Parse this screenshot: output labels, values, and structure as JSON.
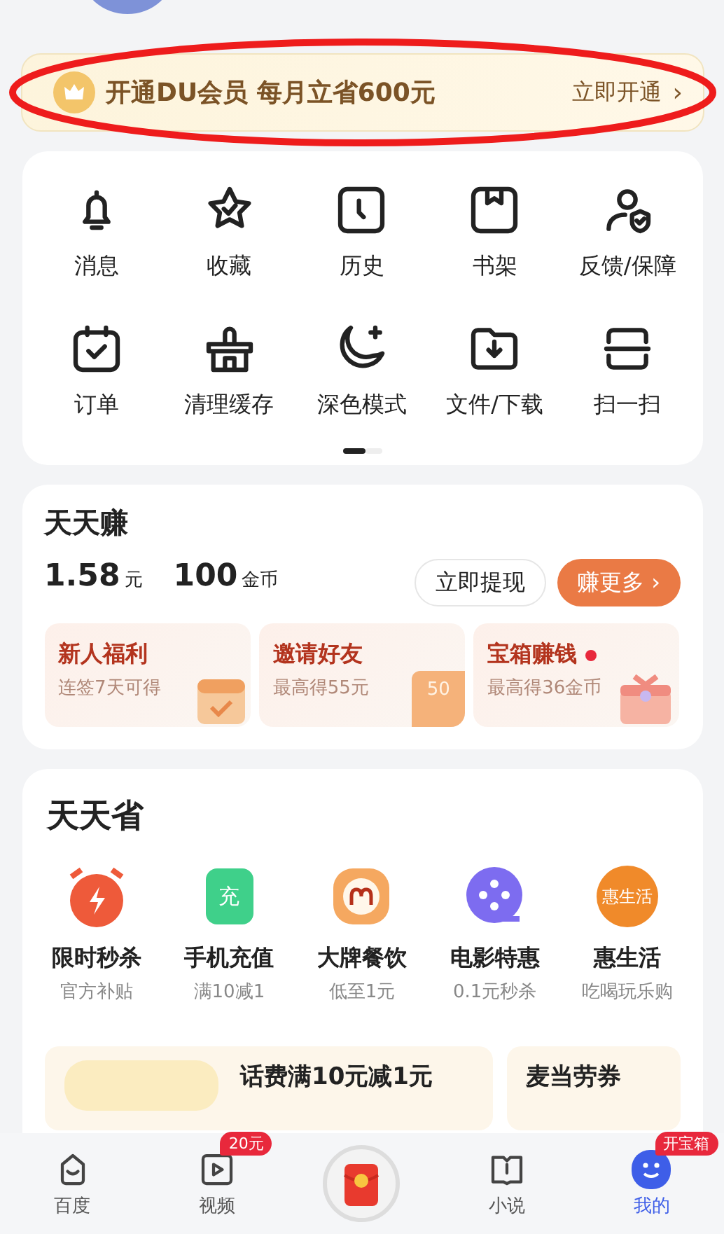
{
  "vip_banner": {
    "title": "开通DU会员 每月立省600元",
    "action": "立即开通",
    "chevron": "›"
  },
  "shortcuts": [
    {
      "label": "消息"
    },
    {
      "label": "收藏"
    },
    {
      "label": "历史"
    },
    {
      "label": "书架"
    },
    {
      "label": "反馈/保障"
    },
    {
      "label": "订单"
    },
    {
      "label": "清理缓存"
    },
    {
      "label": "深色模式"
    },
    {
      "label": "文件/下载"
    },
    {
      "label": "扫一扫"
    }
  ],
  "pager": [
    {
      "selected": true
    },
    {
      "selected": false
    }
  ],
  "earn": {
    "title": "天天赚",
    "cash": "1.58",
    "cash_unit": "元",
    "coins": "100",
    "coins_unit": "金币",
    "withdraw": "立即提现",
    "more": "赚更多 ›",
    "tasks": [
      {
        "title": "新人福利",
        "subtitle": "连签7天可得",
        "dot": false
      },
      {
        "title": "邀请好友",
        "subtitle": "最高得55元",
        "badge": "50",
        "dot": false
      },
      {
        "title": "宝箱赚钱",
        "subtitle": "最高得36金币",
        "dot": true
      }
    ]
  },
  "save": {
    "title": "天天省",
    "items": [
      {
        "title": "限时秒杀",
        "subtitle": "官方补贴",
        "color": "#ee5a3a"
      },
      {
        "title": "手机充值",
        "subtitle": "满10减1",
        "icon_text": "充",
        "color": "#3fd08a"
      },
      {
        "title": "大牌餐饮",
        "subtitle": "低至1元",
        "color": "#f5a860"
      },
      {
        "title": "电影特惠",
        "subtitle": "0.1元秒杀",
        "color": "#7d6cf0"
      },
      {
        "title": "惠生活",
        "subtitle": "吃喝玩乐购",
        "icon_text": "惠生活",
        "color": "#f08a2a"
      }
    ],
    "promos": [
      {
        "title": "话费满10元减1元"
      },
      {
        "title": "麦当劳券"
      }
    ]
  },
  "nav": [
    {
      "kind": "tab",
      "label": "百度",
      "selected": false
    },
    {
      "kind": "tab",
      "label": "视频",
      "badge": "20元",
      "selected": false
    },
    {
      "kind": "center"
    },
    {
      "kind": "tab",
      "label": "小说",
      "selected": false
    },
    {
      "kind": "tab",
      "label": "我的",
      "badge": "开宝箱",
      "selected": true
    }
  ]
}
